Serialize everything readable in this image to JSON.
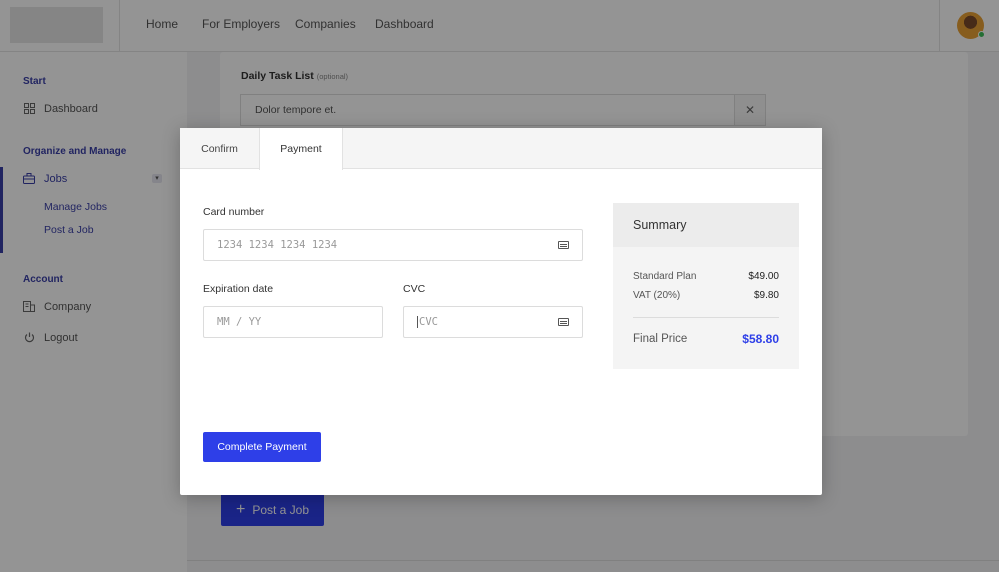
{
  "nav": {
    "links": [
      "Home",
      "For Employers",
      "Companies",
      "Dashboard"
    ]
  },
  "sidebar": {
    "sections": [
      {
        "heading": "Start",
        "items": [
          {
            "label": "Dashboard",
            "icon": "grid-icon"
          }
        ]
      },
      {
        "heading": "Organize and Manage",
        "items": [
          {
            "label": "Jobs",
            "icon": "briefcase-icon"
          }
        ],
        "subitems": [
          "Manage Jobs",
          "Post a Job"
        ]
      },
      {
        "heading": "Account",
        "items": [
          {
            "label": "Company",
            "icon": "building-icon"
          },
          {
            "label": "Logout",
            "icon": "power-icon"
          }
        ]
      }
    ]
  },
  "background": {
    "task_label": "Daily Task List",
    "task_optional": "(optional)",
    "task_value": "Dolor tempore et.",
    "post_job_label": "Post a Job"
  },
  "modal": {
    "tabs": [
      "Confirm",
      "Payment"
    ],
    "active_tab": "Payment",
    "card_number_label": "Card number",
    "card_number_placeholder": "1234 1234 1234 1234",
    "expiration_label": "Expiration date",
    "expiration_placeholder": "MM / YY",
    "cvc_label": "CVC",
    "cvc_placeholder": "CVC",
    "submit_label": "Complete Payment",
    "summary": {
      "title": "Summary",
      "lines": [
        {
          "label": "Standard Plan",
          "amount": "$49.00"
        },
        {
          "label": "VAT (20%)",
          "amount": "$9.80"
        }
      ],
      "final_label": "Final Price",
      "final_amount": "$58.80"
    }
  },
  "colors": {
    "accent": "#2e3fe8",
    "sidebar_heading": "#3a3fa8"
  }
}
